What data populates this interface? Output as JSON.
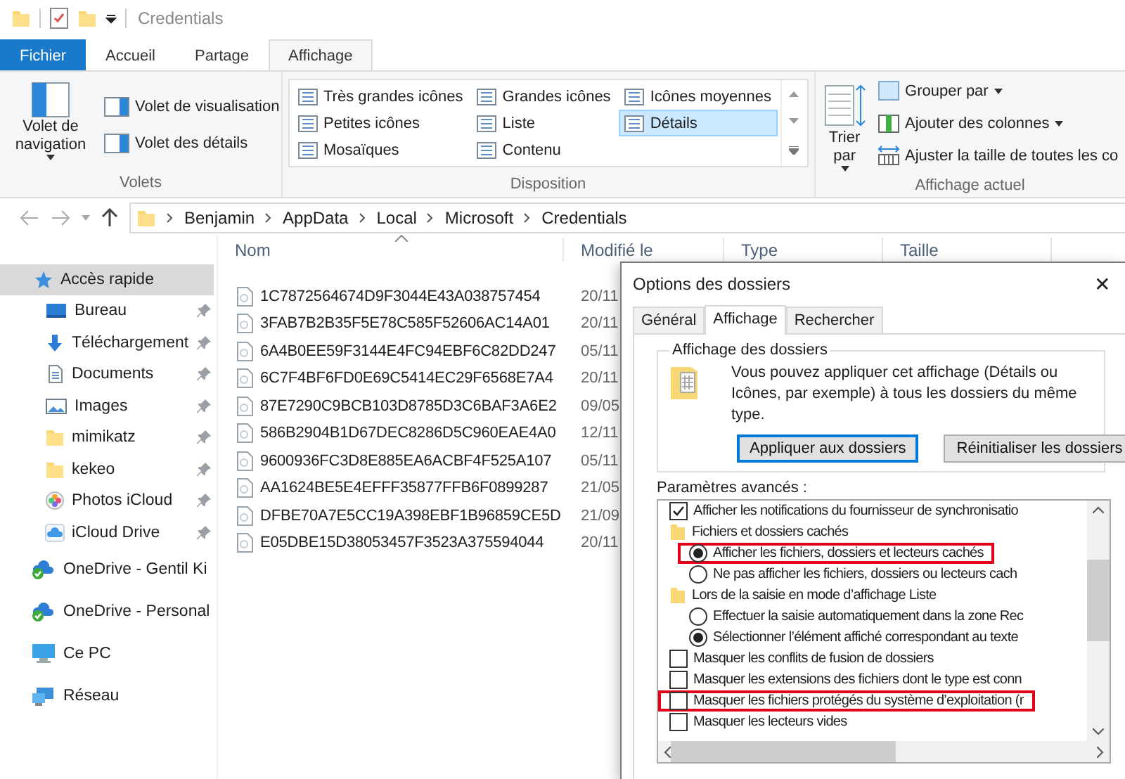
{
  "window": {
    "title": "Credentials"
  },
  "ribbon_tabs": [
    {
      "label": "Fichier",
      "kind": "file",
      "selected": false
    },
    {
      "label": "Accueil",
      "kind": "tab",
      "selected": false
    },
    {
      "label": "Partage",
      "kind": "tab",
      "selected": false
    },
    {
      "label": "Affichage",
      "kind": "tab",
      "selected": true
    }
  ],
  "ribbon": {
    "panes": {
      "label": "Volets",
      "large": "Volet de navigation",
      "items": [
        "Volet de visualisation",
        "Volet des détails"
      ]
    },
    "layout": {
      "label": "Disposition",
      "items": [
        {
          "label": "Très grandes icônes",
          "selected": false
        },
        {
          "label": "Grandes icônes",
          "selected": false
        },
        {
          "label": "Icônes moyennes",
          "selected": false
        },
        {
          "label": "Petites icônes",
          "selected": false
        },
        {
          "label": "Liste",
          "selected": false
        },
        {
          "label": "Détails",
          "selected": true
        },
        {
          "label": "Mosaïques",
          "selected": false
        },
        {
          "label": "Contenu",
          "selected": false
        }
      ]
    },
    "current_view": {
      "label": "Affichage actuel",
      "large": "Trier par",
      "items": [
        {
          "label": "Grouper par",
          "kind": "group",
          "dropdown": true
        },
        {
          "label": "Ajouter des colonnes",
          "kind": "columns",
          "dropdown": true
        },
        {
          "label": "Ajuster la taille de toutes les co",
          "kind": "fit",
          "dropdown": false
        }
      ]
    }
  },
  "address": {
    "path": [
      "Benjamin",
      "AppData",
      "Local",
      "Microsoft",
      "Credentials"
    ]
  },
  "nav": {
    "items": [
      {
        "label": "Accès rapide",
        "kind": "star",
        "selected": true,
        "children": [
          {
            "label": "Bureau",
            "kind": "desktop",
            "selected": false,
            "pinned": true
          },
          {
            "label": "Téléchargement",
            "kind": "download",
            "selected": false,
            "pinned": true
          },
          {
            "label": "Documents",
            "kind": "document",
            "selected": false,
            "pinned": true
          },
          {
            "label": "Images",
            "kind": "images",
            "selected": false,
            "pinned": true
          },
          {
            "label": "mimikatz",
            "kind": "folder",
            "selected": false,
            "pinned": true
          },
          {
            "label": "kekeo",
            "kind": "folder",
            "selected": false,
            "pinned": true
          },
          {
            "label": "Photos iCloud",
            "kind": "photos",
            "selected": false,
            "pinned": true
          },
          {
            "label": "iCloud Drive",
            "kind": "cloud",
            "selected": false,
            "pinned": true
          }
        ]
      },
      {
        "label": "OneDrive - Gentil Ki",
        "kind": "onedrive",
        "selected": false
      },
      {
        "label": "OneDrive - Personal",
        "kind": "onedrive",
        "selected": false
      },
      {
        "label": "Ce PC",
        "kind": "pc",
        "selected": false
      },
      {
        "label": "Réseau",
        "kind": "network",
        "selected": false
      }
    ]
  },
  "files": {
    "columns": [
      "Nom",
      "Modifié le",
      "Type",
      "Taille"
    ],
    "rows": [
      {
        "name": "1C7872564674D9F3044E43A038757454",
        "modified": "20/11"
      },
      {
        "name": "3FAB7B2B35F5E78C585F52606AC14A01",
        "modified": "20/11"
      },
      {
        "name": "6A4B0EE59F3144E4FC94EBF6C82DD247",
        "modified": "05/11"
      },
      {
        "name": "6C7F4BF6FD0E69C5414EC29F6568E7A4",
        "modified": "20/11"
      },
      {
        "name": "87E7290C9BCB103D8785D3C6BAF3A6E2",
        "modified": "09/05"
      },
      {
        "name": "586B2904B1D67DEC8286D5C960EAE4A0",
        "modified": "12/11"
      },
      {
        "name": "9600936FC3D8E885EA6ACBF4F525A107",
        "modified": "05/11"
      },
      {
        "name": "AA1624BE5E4EFFF35877FFB6F0899287",
        "modified": "21/05"
      },
      {
        "name": "DFBE70A7E5CC19A398EBF1B96859CE5D",
        "modified": "21/09"
      },
      {
        "name": "E05DBE15D38053457F3523A375594044",
        "modified": "20/11"
      }
    ]
  },
  "dialog": {
    "title": "Options des dossiers",
    "close": "✕",
    "tabs": [
      {
        "label": "Général",
        "selected": false
      },
      {
        "label": "Affichage",
        "selected": true
      },
      {
        "label": "Rechercher",
        "selected": false
      }
    ],
    "group_title": "Affichage des dossiers",
    "description": "Vous pouvez appliquer cet affichage (Détails ou Icônes, par exemple) à tous les dossiers du même type.",
    "buttons": [
      {
        "label": "Appliquer aux dossiers",
        "default": true
      },
      {
        "label": "Réinitialiser les dossiers",
        "default": false
      }
    ],
    "advanced_label": "Paramètres avancés :",
    "settings": [
      {
        "kind": "checkbox",
        "label": "Afficher les notifications du fournisseur de synchronisatio",
        "checked": true,
        "highlighted": false
      },
      {
        "kind": "group",
        "label": "Fichiers et dossiers cachés",
        "children": [
          {
            "kind": "radio",
            "label": "Afficher les fichiers, dossiers et lecteurs cachés",
            "checked": true,
            "highlighted": true
          },
          {
            "kind": "radio",
            "label": "Ne pas afficher les fichiers, dossiers ou lecteurs cach",
            "checked": false,
            "highlighted": false
          }
        ]
      },
      {
        "kind": "group",
        "label": "Lors de la saisie en mode d’affichage Liste",
        "children": [
          {
            "kind": "radio",
            "label": "Effectuer la saisie automatiquement dans la zone Rec",
            "checked": false,
            "highlighted": false
          },
          {
            "kind": "radio",
            "label": "Sélectionner l’élément affiché correspondant au texte",
            "checked": true,
            "highlighted": false
          }
        ]
      },
      {
        "kind": "checkbox",
        "label": "Masquer les conflits de fusion de dossiers",
        "checked": false,
        "highlighted": false
      },
      {
        "kind": "checkbox",
        "label": "Masquer les extensions des fichiers dont le type est conn",
        "checked": false,
        "highlighted": false
      },
      {
        "kind": "checkbox",
        "label": "Masquer les fichiers protégés du système d’exploitation (r",
        "checked": false,
        "highlighted": true
      },
      {
        "kind": "checkbox",
        "label": "Masquer les lecteurs vides",
        "checked": false,
        "highlighted": false
      }
    ]
  }
}
